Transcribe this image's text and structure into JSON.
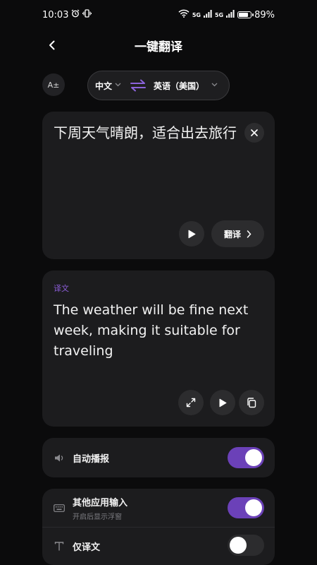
{
  "status_bar": {
    "time": "10:03",
    "network_1": "5G",
    "network_2": "5G",
    "battery": "89%",
    "battery_level": 0.89
  },
  "header": {
    "title": "一键翻译"
  },
  "language_bar": {
    "font_button": "A±",
    "source_language": "中文",
    "target_language": "英语（美国）"
  },
  "source": {
    "text": "下周天气晴朗，适合出去旅行",
    "translate_label": "翻译"
  },
  "result": {
    "label": "译文",
    "text": "The weather will be fine next week, making it suitable for traveling"
  },
  "settings": {
    "auto_play": {
      "title": "自动播报",
      "enabled": true
    },
    "other_apps": {
      "title": "其他应用输入",
      "subtitle": "开启后显示浮窗",
      "enabled": true
    },
    "translation_only": {
      "title": "仅译文",
      "enabled": false
    }
  },
  "colors": {
    "accent": "#6b41b8",
    "label_purple": "#8b5cd6",
    "card_bg": "#1c1c1e",
    "page_bg": "#0b0b0c"
  }
}
